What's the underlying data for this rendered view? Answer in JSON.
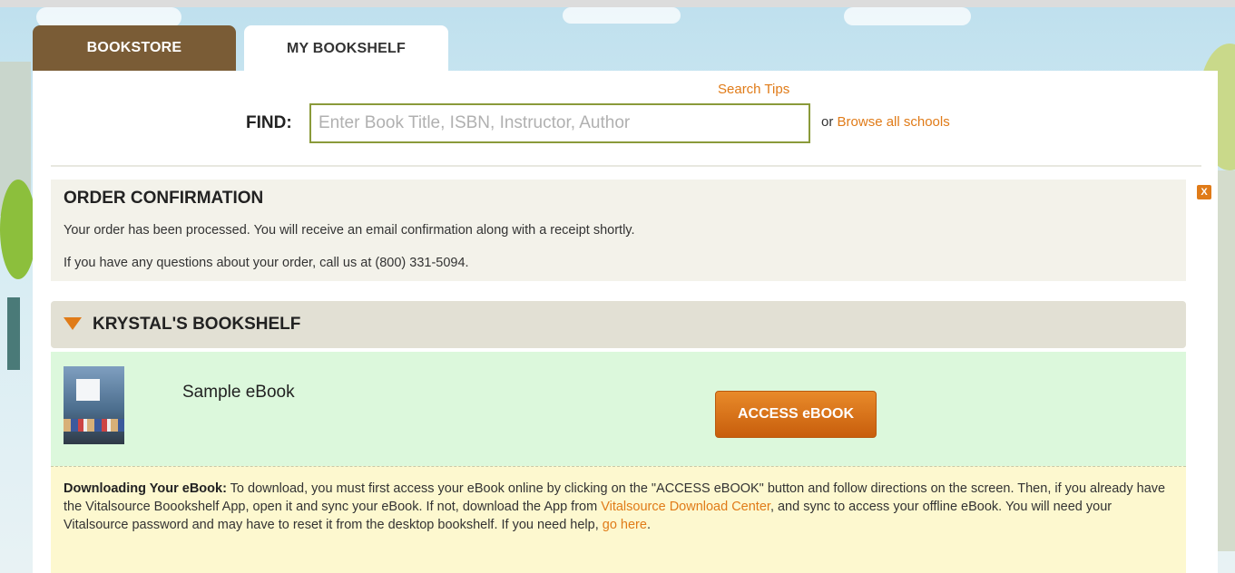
{
  "tabs": [
    {
      "label": "BOOKSTORE",
      "active": false
    },
    {
      "label": "MY BOOKSHELF",
      "active": true
    }
  ],
  "search": {
    "tips_label": "Search Tips",
    "find_label": "FIND:",
    "placeholder": "Enter Book Title, ISBN, Instructor, Author",
    "value": "",
    "or_text": "or",
    "browse_label": "Browse all schools"
  },
  "order_confirmation": {
    "title": "ORDER CONFIRMATION",
    "message": "Your order has been processed. You will receive an email confirmation along with a receipt shortly.",
    "contact": "If you have any questions about your order, call us at (800) 331-5094.",
    "close_label": "X"
  },
  "bookshelf": {
    "title": "KRYSTAL'S BOOKSHELF",
    "expanded": true,
    "books": [
      {
        "title": "Sample eBook",
        "action_label": "ACCESS eBOOK"
      }
    ]
  },
  "download_notice": {
    "heading": "Downloading Your eBook:",
    "text_1": " To download, you must first access your eBook online by clicking on the \"ACCESS eBOOK\" button and follow directions on the screen. Then, if you already have the Vitalsource Boookshelf App, open it and sync your eBook. If not, download the App from ",
    "link_1": "Vitalsource Download Center",
    "text_2": ", and sync to access your offline eBook. You will need your Vitalsource password and may have to reset it from the desktop bookshelf. If you need help, ",
    "link_2": "go here",
    "text_3": "."
  },
  "colors": {
    "accent": "#e07b18",
    "tab_brown": "#7a5c36",
    "book_row_bg": "#dcf8dc",
    "notice_bg": "#fdf8cf"
  }
}
